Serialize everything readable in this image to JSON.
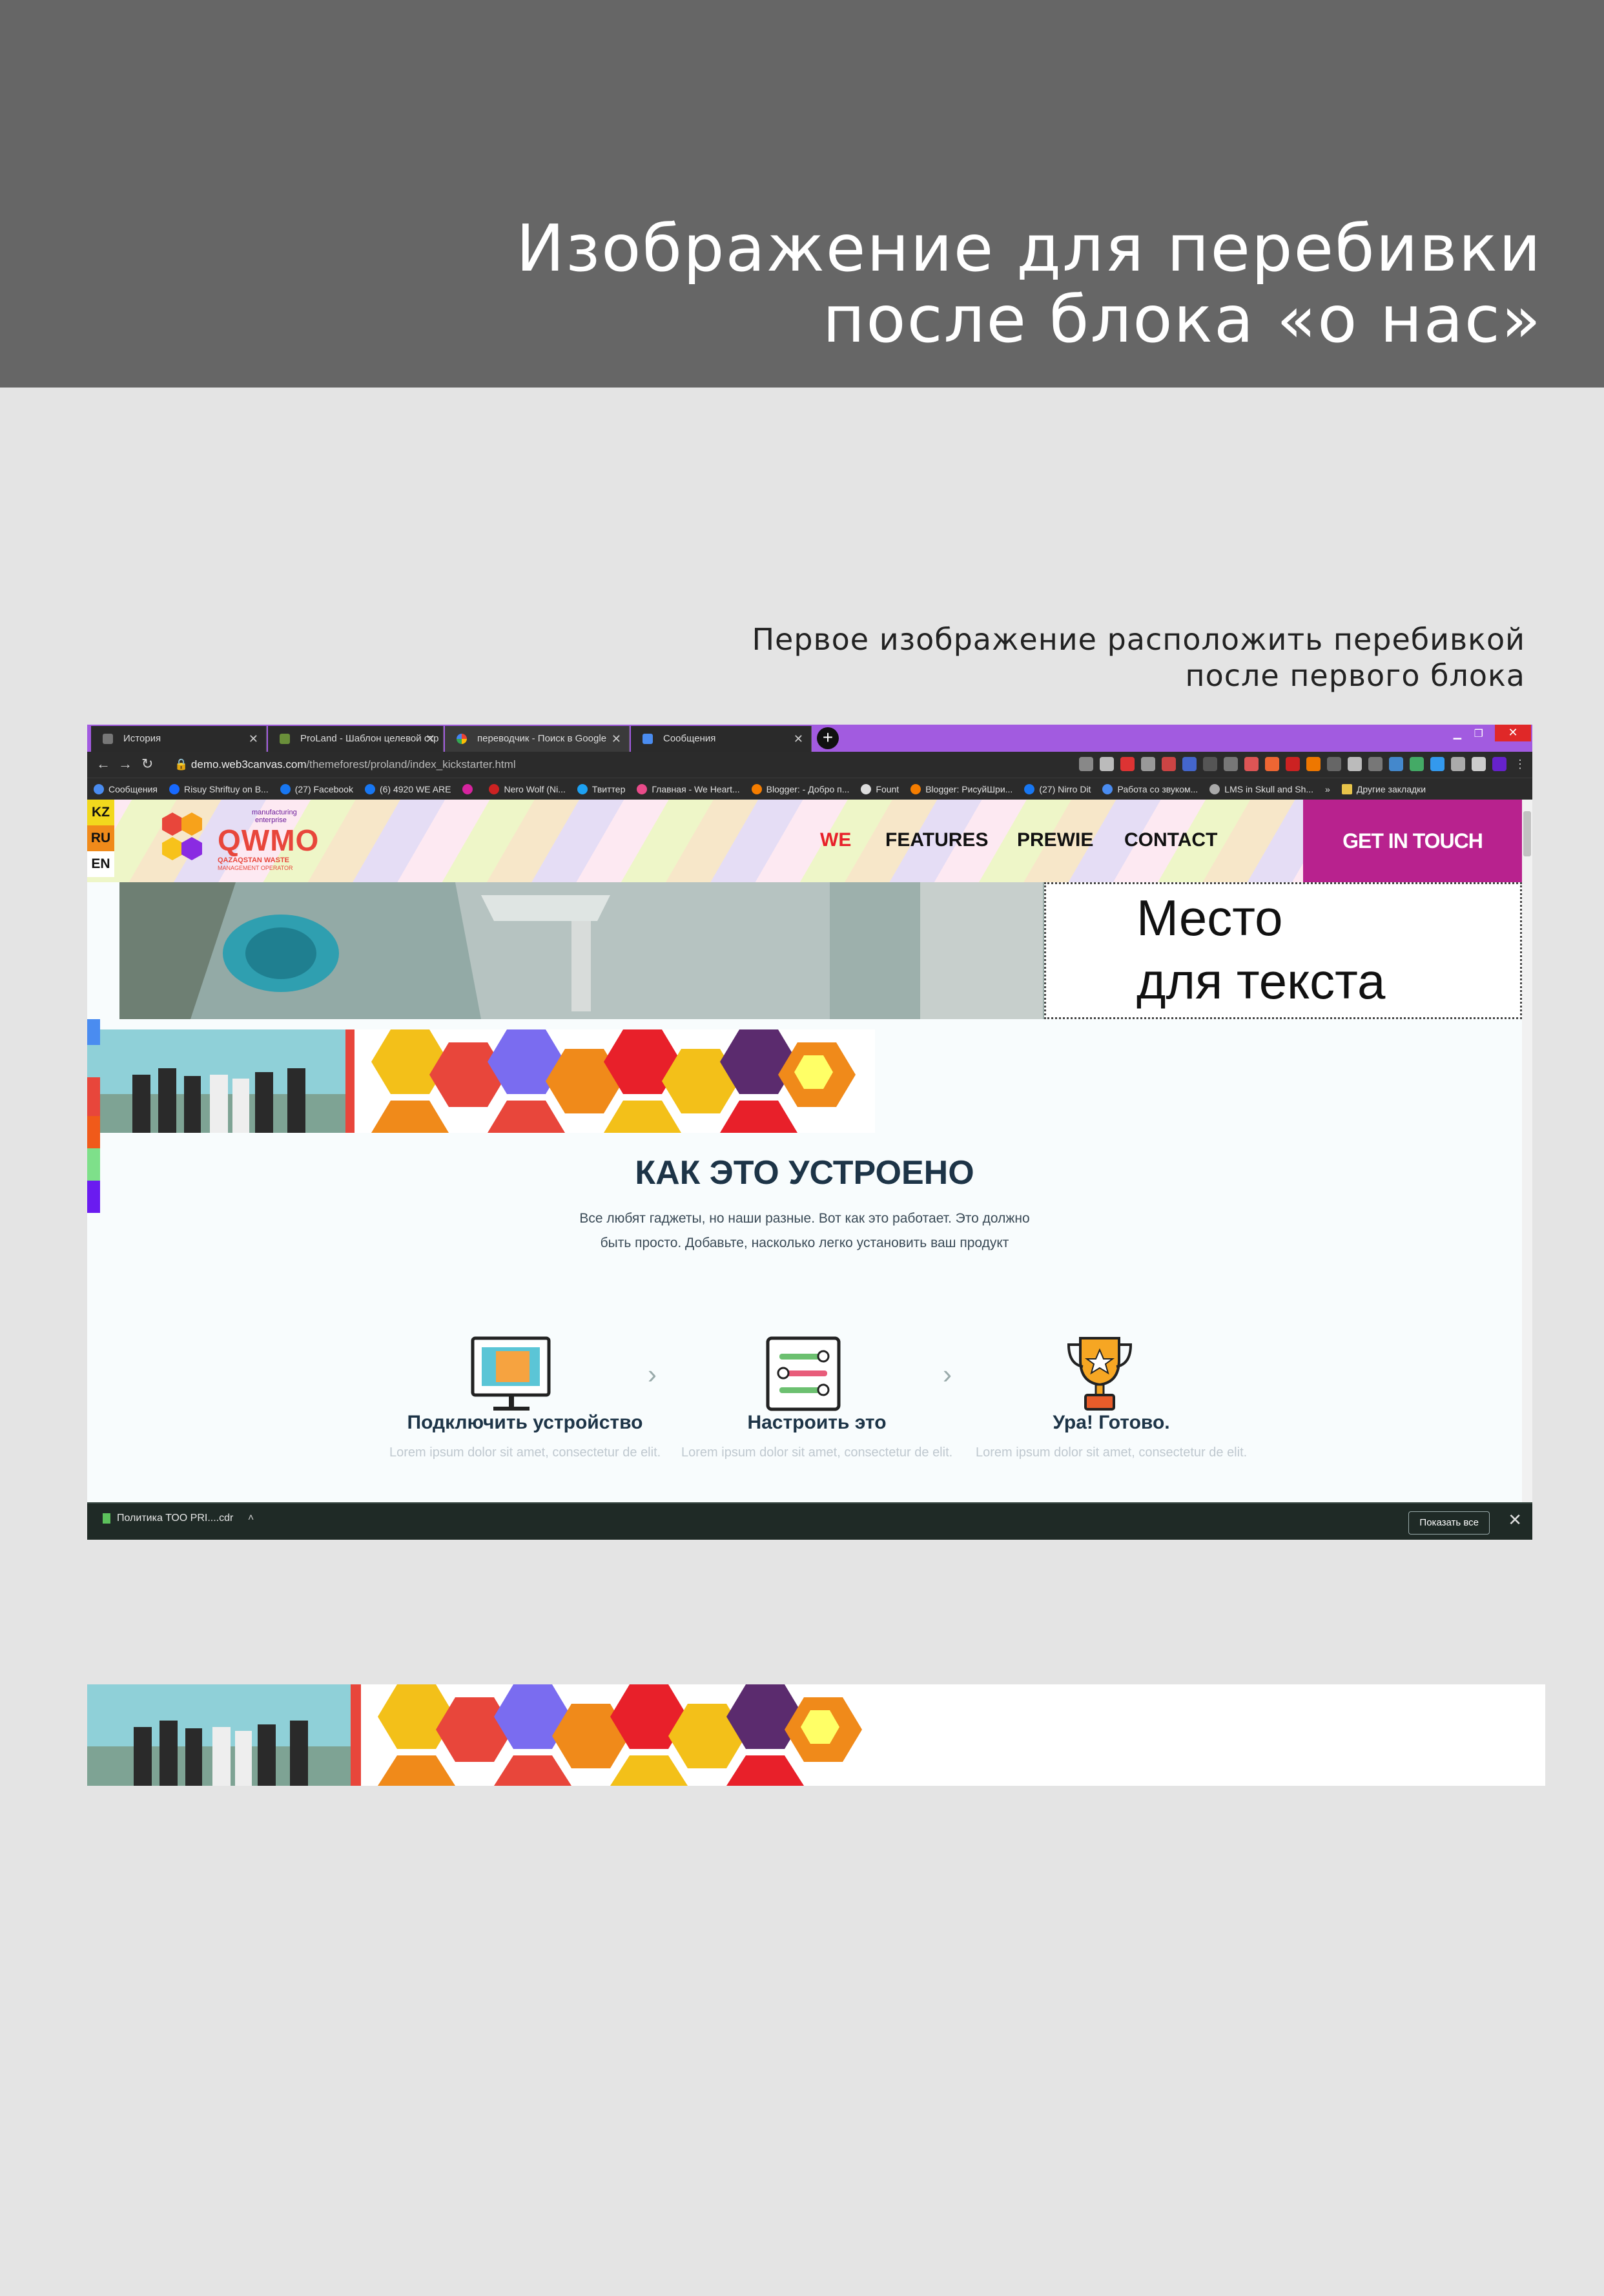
{
  "page": {
    "title_lines": [
      "Изображение для перебивки",
      "после блока «о нас»"
    ],
    "note_lines": [
      "Первое изображение расположить перебивкой",
      "после первого блока"
    ]
  },
  "browser": {
    "tabs": [
      {
        "label": "История",
        "icon": "history-icon"
      },
      {
        "label": "ProLand - Шаблон целевой стр",
        "icon": "proland-icon"
      },
      {
        "label": "переводчик - Поиск в Google",
        "icon": "google-icon"
      },
      {
        "label": "Сообщения",
        "icon": "messages-icon"
      }
    ],
    "url_host": "demo.web3canvas.com",
    "url_path": "/themeforest/proland/index_kickstarter.html",
    "bookmarks": [
      "Сообщения",
      "Risuy Shriftuy on B...",
      "(27) Facebook",
      "(6) 4920 WE ARE",
      "",
      "Nero Wolf (Ni...",
      "Твиттер",
      "Главная - We Heart...",
      "Blogger: - Добро п...",
      "Fount",
      "Blogger: РисуйШри...",
      "(27) Nirro Dit",
      "Работа со звуком...",
      "LMS in Skull and Sh...",
      "»",
      "Другие закладки"
    ]
  },
  "site": {
    "languages": [
      "KZ",
      "RU",
      "EN"
    ],
    "logo": {
      "tagline1": "manufacturing",
      "tagline2": "enterprise",
      "word": "QWMO",
      "sub1": "QAZAQSTAN WASTE",
      "sub2": "MANAGEMENT OPERATOR"
    },
    "nav": [
      "WE",
      "FEATURES",
      "PREWIE",
      "CONTACT"
    ],
    "cta": "GET IN TOUCH",
    "placeholder_lines": [
      "Место",
      "для текста"
    ],
    "how": {
      "title": "КАК ЭТО УСТРОЕНО",
      "subtitle_lines": [
        "Все любят гаджеты, но наши разные. Вот как это работает. Это должно",
        "быть просто. Добавьте, насколько легко установить ваш продукт"
      ],
      "features": [
        {
          "title": "Подключить устройство",
          "desc": "Lorem ipsum dolor sit amet, consectetur de elit.",
          "icon": "monitor-icon"
        },
        {
          "title": "Настроить это",
          "desc": "Lorem ipsum dolor sit amet, consectetur de elit.",
          "icon": "settings-list-icon"
        },
        {
          "title": "Ура! Готово.",
          "desc": "Lorem ipsum dolor sit amet, consectetur de elit.",
          "icon": "trophy-icon"
        }
      ]
    }
  },
  "download": {
    "file": "Политика ТОО PRI....cdr",
    "show_all": "Показать все"
  },
  "colors": {
    "header_gray": "#666666",
    "background": "#e4e4e4",
    "cta": "#b8228e",
    "tabstrip": "#a25be0",
    "title_dark": "#1d3447"
  }
}
